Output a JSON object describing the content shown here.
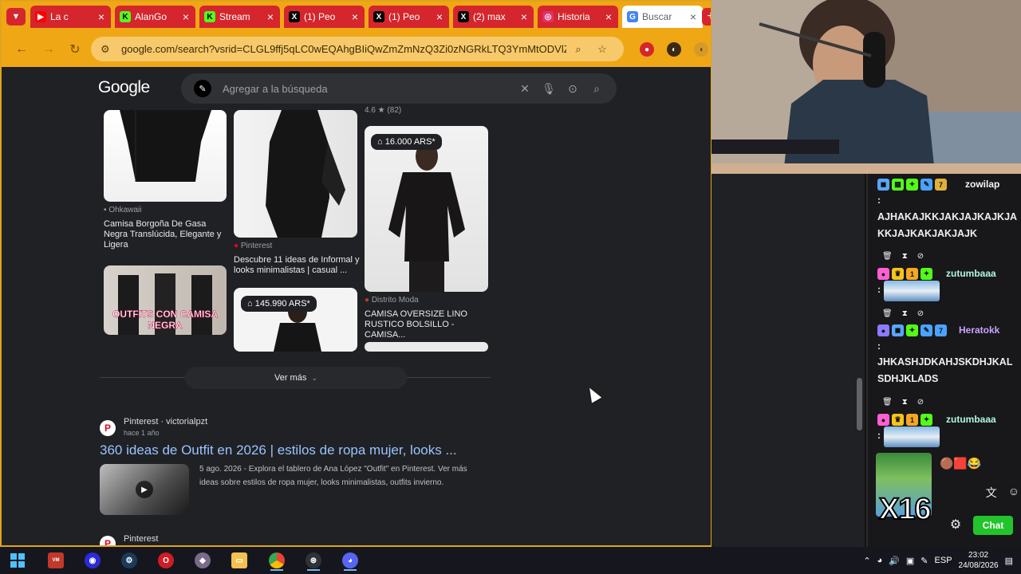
{
  "browser": {
    "tabs": [
      {
        "title": "La c",
        "favicon": "youtube-icon",
        "color": "#ff0000"
      },
      {
        "title": "AlanGo",
        "favicon": "kick-icon",
        "color": "#53fc18"
      },
      {
        "title": "Stream",
        "favicon": "kick-icon",
        "color": "#53fc18"
      },
      {
        "title": "(1) Peo",
        "favicon": "x-icon",
        "color": "#000000"
      },
      {
        "title": "(1) Peo",
        "favicon": "x-icon",
        "color": "#000000"
      },
      {
        "title": "(2) max",
        "favicon": "x-icon",
        "color": "#000000"
      },
      {
        "title": "Historia",
        "favicon": "instagram-icon",
        "color": "#e1306c"
      },
      {
        "title": "Buscar",
        "favicon": "google-icon",
        "color": "#4285f4"
      }
    ],
    "url": "google.com/search?vsrid=CLGL9ffj5qLC0wEQAhgBIiQwZmZmNzQ3Zi0zNGRkLTQ3YmMtODVlZ"
  },
  "search": {
    "logo": "Google",
    "placeholder": "Agregar a la búsqueda"
  },
  "images": {
    "rating": "4.6 ★ (82)",
    "items": [
      {
        "source": "Ohkawaii",
        "caption": "Camisa Borgoña De Gasa Negra Translúcida, Elegante y Ligera"
      },
      {
        "source": "Pinterest",
        "caption": "Descubre 11 ideas de Informal y looks minimalistas | casual ..."
      },
      {
        "price": "16.000 ARS*",
        "source": "Distrito Moda",
        "caption": "CAMISA OVERSIZE LINO RUSTICO BOLSILLO - CAMISA..."
      },
      {
        "overlay_text": "OUTFITS CON CAMISA NEGRA"
      },
      {
        "price": "145.990 ARS*"
      }
    ],
    "more_label": "Ver más"
  },
  "results": [
    {
      "site": "Pinterest · victorialpzt",
      "age": "hace 1 año",
      "title": "360 ideas de Outfit en 2026 | estilos de ropa mujer, looks ...",
      "snippet": "5 ago. 2026 - Explora el tablero de Ana López \"Outfit\" en Pinterest. Ver más ideas sobre estilos de ropa mujer, looks minimalistas, outfits invierno."
    },
    {
      "site": "Pinterest"
    }
  ],
  "chat": {
    "messages": [
      {
        "user": "zowilap",
        "user_color": "#f5f5f5",
        "text": "AJHAKAJKKJAKJAJKAJKJAKKJAJKAKJAKJAJK"
      },
      {
        "user": "zutumbaaa",
        "user_color": "#b2f5e4",
        "text": ""
      },
      {
        "user": "Heratokk",
        "user_color": "#c9a3ff",
        "text": "JHKASHJDKAHJSKDHJKALSDHJKLADS"
      },
      {
        "user": "zutumbaaa",
        "user_color": "#b2f5e4",
        "text": ""
      }
    ],
    "multiplier": "X16",
    "chat_button": "Chat"
  },
  "taskbar": {
    "language": "ESP",
    "time": "23:02",
    "date": "24/08/2026"
  }
}
